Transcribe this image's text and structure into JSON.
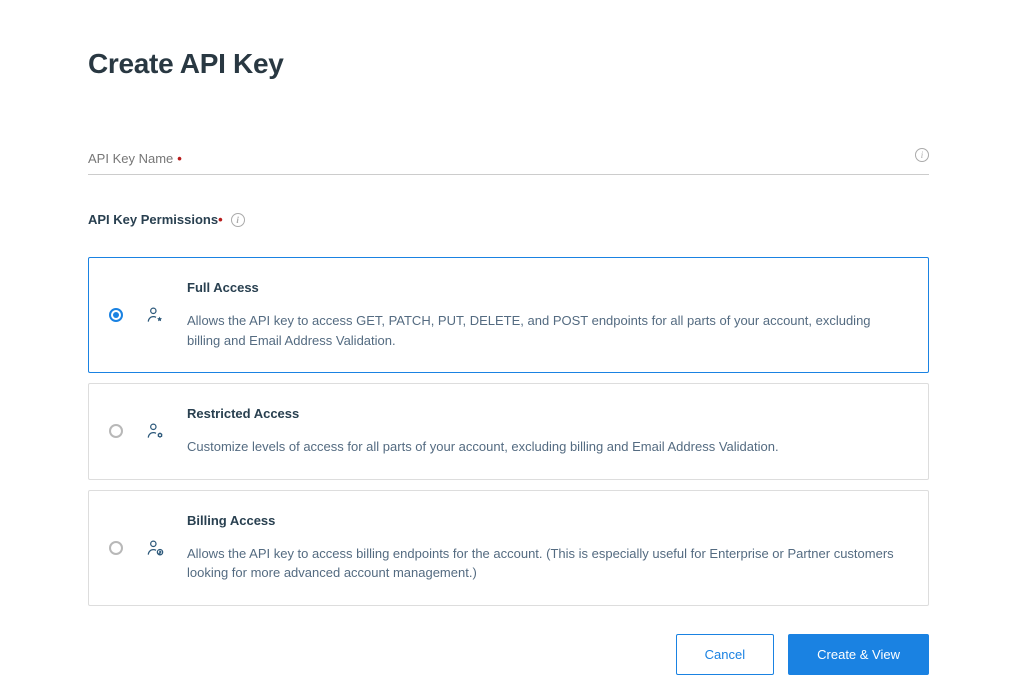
{
  "title": "Create API Key",
  "field": {
    "label": "API Key Name",
    "value": "",
    "placeholder": ""
  },
  "permissions_label": "API Key Permissions",
  "options": [
    {
      "title": "Full Access",
      "desc": "Allows the API key to access GET, PATCH, PUT, DELETE, and POST endpoints for all parts of your account, excluding billing and Email Address Validation.",
      "selected": true,
      "icon": "user-star-icon"
    },
    {
      "title": "Restricted Access",
      "desc": "Customize levels of access for all parts of your account, excluding billing and Email Address Validation.",
      "selected": false,
      "icon": "user-gear-icon"
    },
    {
      "title": "Billing Access",
      "desc": "Allows the API key to access billing endpoints for the account. (This is especially useful for Enterprise or Partner customers looking for more advanced account management.)",
      "selected": false,
      "icon": "user-dollar-icon"
    }
  ],
  "actions": {
    "cancel": "Cancel",
    "submit": "Create & View"
  }
}
